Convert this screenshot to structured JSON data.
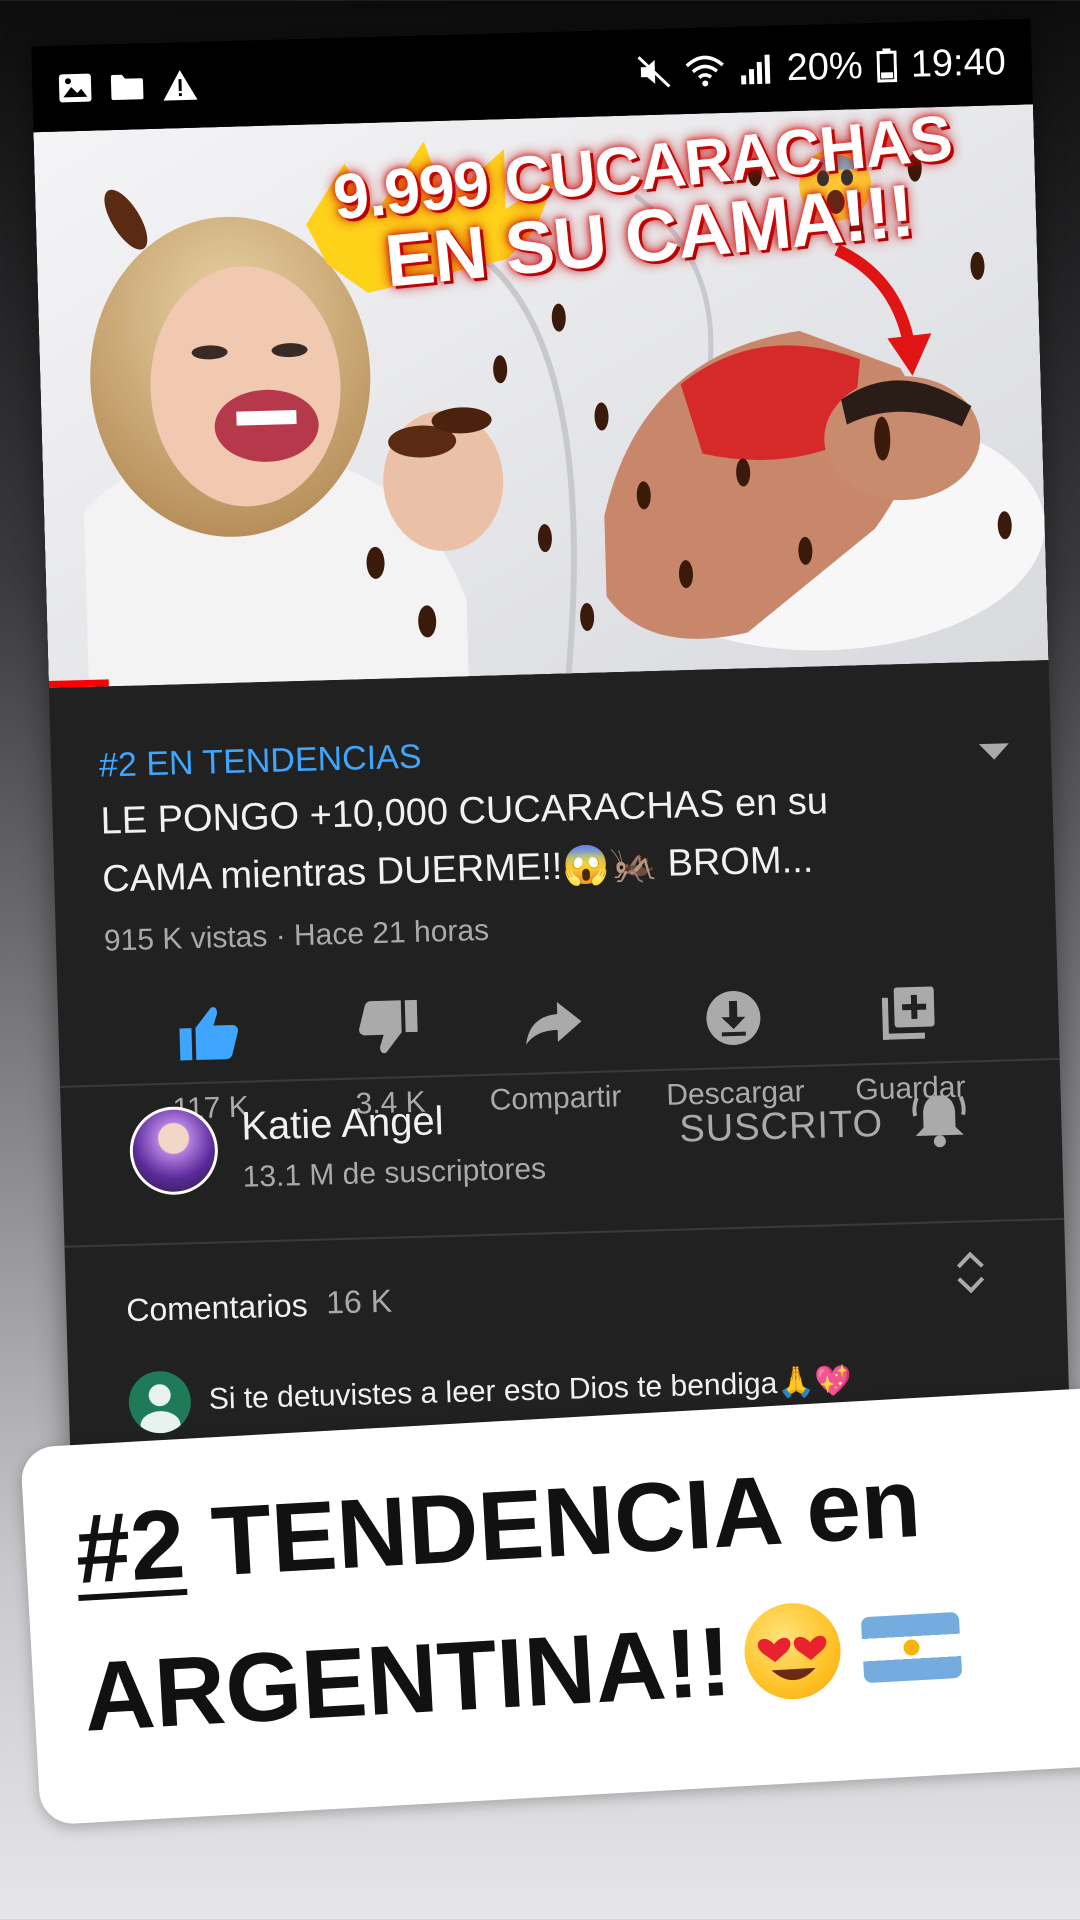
{
  "status_bar": {
    "battery": "20%",
    "time": "19:40",
    "left_icons": [
      "image-icon",
      "folder-icon",
      "warning-icon"
    ],
    "right_icons": [
      "mute-icon",
      "wifi-icon",
      "signal-icon",
      "battery-icon"
    ]
  },
  "thumbnail": {
    "headline_line1": "9.999 CUCARACHAS",
    "headline_line2": "EN SU CAMA!!!",
    "emoji": "scream-emoji",
    "progress": 0.06,
    "colors": {
      "headline_glow": "#e01010",
      "progress": "#ff0000"
    }
  },
  "video": {
    "trending_label": "#2 EN TENDENCIAS",
    "title_line1": "LE PONGO +10,000 CUCARACHAS en su",
    "title_line2": "CAMA mientras DUERME!!😱🦗  BROM...",
    "meta": "915 K vistas · Hace 21 horas"
  },
  "actions": [
    {
      "icon": "thumbs-up-icon",
      "label": "117 K",
      "active": true
    },
    {
      "icon": "thumbs-down-icon",
      "label": "3.4 K"
    },
    {
      "icon": "share-icon",
      "label": "Compartir"
    },
    {
      "icon": "download-icon",
      "label": "Descargar"
    },
    {
      "icon": "add-to-playlist-icon",
      "label": "Guardar"
    }
  ],
  "channel": {
    "name": "Katie Angel",
    "subscribers": "13.1 M de suscriptores",
    "subscribe_state": "SUSCRITO"
  },
  "comments": {
    "label": "Comentarios",
    "count": "16 K",
    "first_comment": "Si te detuvistes a leer esto Dios te bendiga🙏💖"
  },
  "caption": {
    "rank": "#2",
    "line1_rest": " TENDENCIA en",
    "line2": "ARGENTINA!!",
    "emoji": "heart-eyes-emoji",
    "flag": "argentina-flag"
  },
  "colors": {
    "accent_blue": "#3ea6ff",
    "like_active": "#3ea6ff",
    "panel_bg": "#212121"
  }
}
